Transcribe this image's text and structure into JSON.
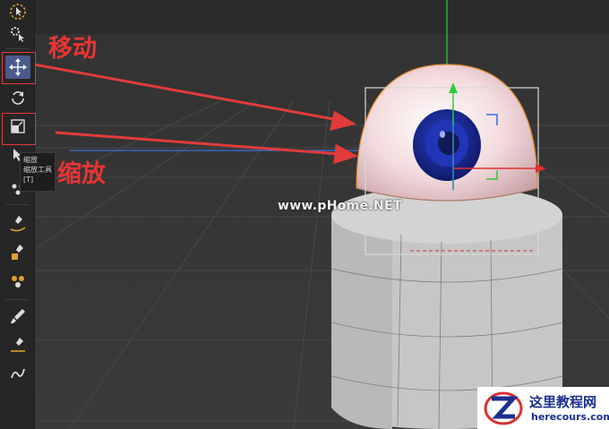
{
  "toolbar": {
    "tools": [
      {
        "id": "live-select",
        "icon": "dashed-circle-select-icon"
      },
      {
        "id": "gear",
        "icon": "gear-cursor-icon"
      },
      {
        "id": "move",
        "icon": "move-arrows-icon",
        "active": true
      },
      {
        "id": "rotate",
        "icon": "rotate-icon"
      },
      {
        "id": "scale",
        "icon": "scale-icon"
      },
      {
        "id": "select",
        "icon": "cursor-icon"
      },
      {
        "id": "brush-group",
        "icon": "brush-icon"
      }
    ],
    "tooltip": {
      "line1": "缩放",
      "line2": "缩放工具",
      "line3": "[T]"
    }
  },
  "annotations": {
    "move_label": "移动",
    "scale_label": "缩放",
    "color": "#e23b3b"
  },
  "viewport": {
    "watermark": "www.pHome.NET",
    "axis_colors": {
      "x": "#e03030",
      "y": "#2ecc40",
      "z": "#3a6fd8"
    }
  },
  "logo": {
    "title": "这里教程网",
    "url": "herecours.com",
    "color": "#1b2f8f"
  }
}
